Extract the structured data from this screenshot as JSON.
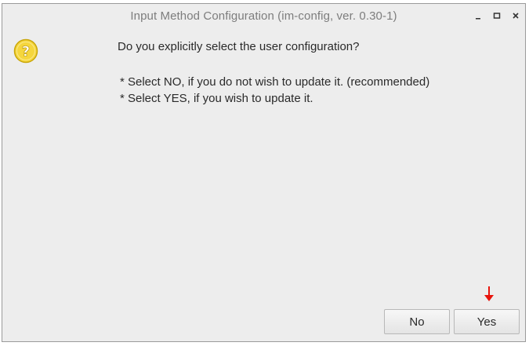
{
  "window": {
    "title": "Input Method Configuration (im-config, ver. 0.30-1)",
    "controls": {
      "minimize_icon": "minimize-icon",
      "maximize_icon": "maximize-icon",
      "close_icon": "close-icon"
    }
  },
  "dialog": {
    "icon": "question-icon",
    "icon_glyph": "?",
    "icon_color": "#f2d43a",
    "question": "Do you explicitly select the user configuration?",
    "info_lines": [
      "* Select NO, if you do not wish to update it. (recommended)",
      "* Select YES, if you wish to update it."
    ]
  },
  "buttons": {
    "no_label": "No",
    "yes_label": "Yes"
  },
  "annotation": {
    "arrow_icon": "red-down-arrow-icon",
    "arrow_color": "#e8140c"
  }
}
